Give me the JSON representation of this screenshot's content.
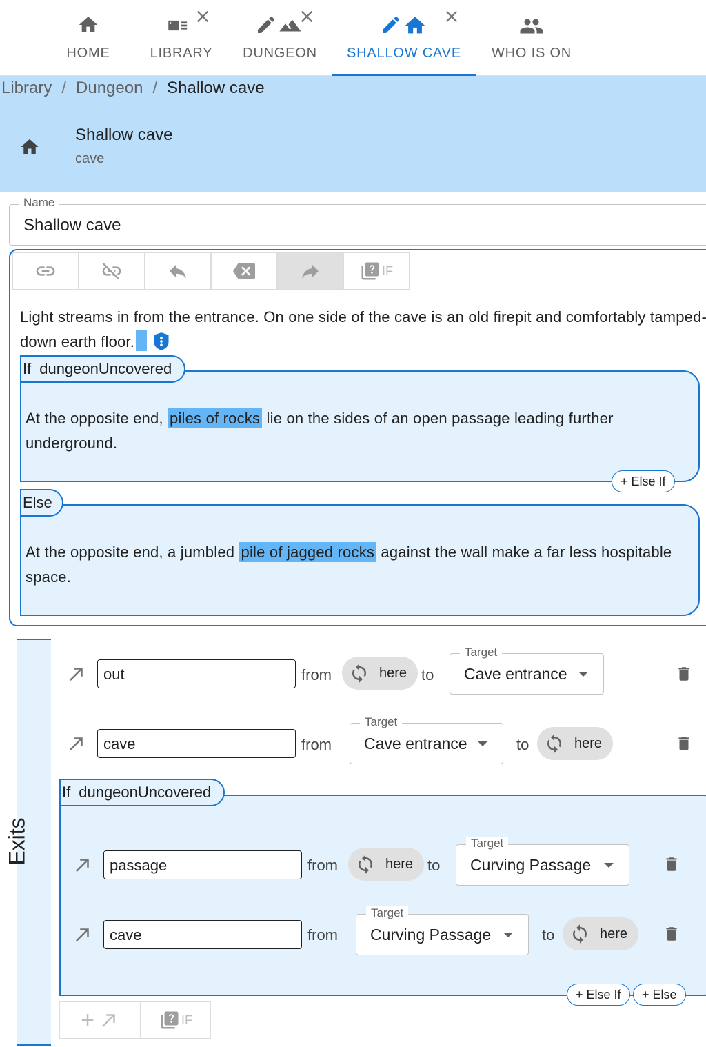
{
  "tabs": [
    {
      "label": "HOME",
      "icons": [
        "home-icon"
      ],
      "closable": false,
      "active": false
    },
    {
      "label": "LIBRARY",
      "icons": [
        "library-card-icon"
      ],
      "closable": true,
      "active": false
    },
    {
      "label": "DUNGEON",
      "icons": [
        "pencil-icon",
        "mountain-icon"
      ],
      "closable": true,
      "active": false
    },
    {
      "label": "SHALLOW CAVE",
      "icons": [
        "pencil-icon",
        "home-icon"
      ],
      "closable": true,
      "active": true
    },
    {
      "label": "WHO IS ON",
      "icons": [
        "people-icon"
      ],
      "closable": false,
      "active": false
    }
  ],
  "breadcrumb": [
    "Library",
    "Dungeon",
    "Shallow cave"
  ],
  "breadcrumb_separator": "/",
  "header": {
    "title": "Shallow cave",
    "subtitle": "cave",
    "icon": "home-icon"
  },
  "name_field": {
    "label": "Name",
    "value": "Shallow cave"
  },
  "toolbar": {
    "buttons": [
      "link-icon",
      "unlink-icon",
      "undo-icon",
      "backspace-icon",
      "redo-icon",
      "conditional-icon"
    ],
    "if_label": "IF"
  },
  "description": {
    "intro": "Light streams in from the entrance. On one side of the cave is an old firepit and comfortably tamped-down earth floor.",
    "if_keyword": "If",
    "condition": "dungeonUncovered",
    "if_text_before": "At the opposite end,",
    "if_link": "piles of rocks",
    "if_text_after": "lie on the sides of an open passage leading further underground.",
    "else_if_button": "+ Else If",
    "else_keyword": "Else",
    "else_text_before": "At the opposite end, a jumbled",
    "else_link": "pile of jagged rocks",
    "else_text_after": "against the wall make a far less hospitable space."
  },
  "exits": {
    "section_label": "Exits",
    "from_word": "from",
    "to_word": "to",
    "here_label": "here",
    "target_label": "Target",
    "rows": [
      {
        "name": "out",
        "target": "Cave entrance"
      },
      {
        "name": "cave",
        "target": "Cave entrance"
      }
    ],
    "conditional": {
      "if_keyword": "If",
      "condition": "dungeonUncovered",
      "rows": [
        {
          "name": "passage",
          "target": "Curving Passage"
        },
        {
          "name": "cave",
          "target": "Curving Passage"
        }
      ],
      "else_if_button": "+ Else If",
      "else_button": "+ Else"
    },
    "add_buttons": {
      "add_exit": "+",
      "if_label": "IF"
    }
  },
  "colors": {
    "accent": "#1976d2",
    "header_bg": "#bbdefb",
    "block_bg": "#e3f2fd",
    "highlight": "#64b5f6"
  }
}
